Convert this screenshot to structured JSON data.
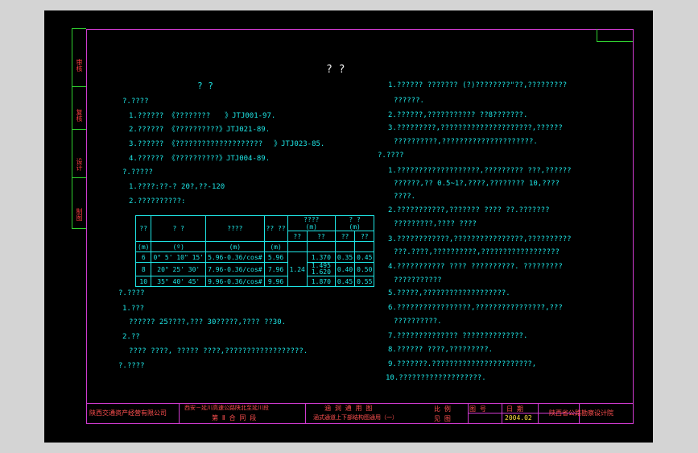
{
  "side_tabs": [
    "审核",
    "复核",
    "设计",
    "制图"
  ],
  "title": "?    ?",
  "subtitle": "?    ?",
  "left": {
    "h1": "?.????",
    "refs": [
      {
        "a": "1.?????? 《????????",
        "b": "》JTJ001-97."
      },
      {
        "a": "2.?????? 《??????????",
        "b": "》JTJ021-89."
      },
      {
        "a": "3.?????? 《????????????????????",
        "b": "》JTJ023-85."
      },
      {
        "a": "4.?????? 《??????????",
        "b": "》JTJ004-89."
      }
    ],
    "h2": "?.?????",
    "p1": "1.????:??-?  20?,??-120",
    "p2": "2.??????????:",
    "table": {
      "head1": [
        "??",
        "?  ?",
        "????",
        "?? ??",
        "????",
        "?  ?"
      ],
      "head1b": [
        "(m)",
        "(m)"
      ],
      "head2": [
        "??",
        "??",
        "??",
        "??"
      ],
      "units": [
        "(m)",
        "(º)",
        "(m)",
        "(m)"
      ],
      "rows": [
        {
          "r": "6",
          "ang": "0° 5' 10\" 15'",
          "f": "5.96-0.36/cos#",
          "v": "5.96",
          "h1": "1.370",
          "c1": "0.35",
          "c2": "0.45"
        },
        {
          "r": "8",
          "ang": "20° 25' 30'",
          "f": "7.96-0.36/cos#",
          "v": "7.96",
          "h1": "1.495 1.620",
          "c1": "0.40",
          "c2": "0.50"
        },
        {
          "r": "10",
          "ang": "35° 40' 45'",
          "f": "9.96-0.36/cos#",
          "v": "9.96",
          "h1": "1.870",
          "c1": "0.45",
          "c2": "0.55"
        }
      ],
      "merged": "1.24"
    },
    "h3": "?.????",
    "q1": "1.???",
    "q1t": "?????? 25????,???    30?????,????    ??30.",
    "q2": "2.??",
    "q2t": "???? ????, ????? ????,??????????????????.",
    "h4": "?.????"
  },
  "right": {
    "lines": [
      "1.??????  ???????  (?)????????\"??,?????????",
      "??????.",
      "2.??????,???????????  ??8???????.",
      "3.?????????,?????????????????????,??????",
      "??????????,?????????????????????."
    ],
    "h": "?.????",
    "items": [
      "1.???????????????????,?????????      ???,??????",
      "??????,??  0.5~1?,????,????????     10,????",
      "????.",
      "2.???????????,???????      ????  ??.???????",
      "?????????,????  ????",
      "3.????????????,????????????????,??????????",
      "???.????,??????????,??????????????????",
      "4.???????????  ????  ??????????.      ?????????",
      "???????????",
      "5.?????,???????????????????.",
      "6.?????????????????,????????????????,???",
      "??????????.",
      "7.??????????????    ??????????????.",
      "8.??????  ????,?????????.",
      "9.???????.???????????????????????,",
      "10.???????????????????."
    ]
  },
  "title_block": {
    "company": "陕西交通资产经营有限公司",
    "project1": "西安－延川高速公路陕北至延川段",
    "project2": "第 Ⅱ 合 同 段",
    "drawing1": "涵 洞 通 用 图",
    "drawing2": "涵式通道上下部结构图通用（一）",
    "scale_lbl": "比 例",
    "fig_lbl": "图 号",
    "date_lbl": "日 期",
    "scale_val": "见 图",
    "date_val": "2004.02",
    "designer": "陕西省公路勘察设计院"
  }
}
